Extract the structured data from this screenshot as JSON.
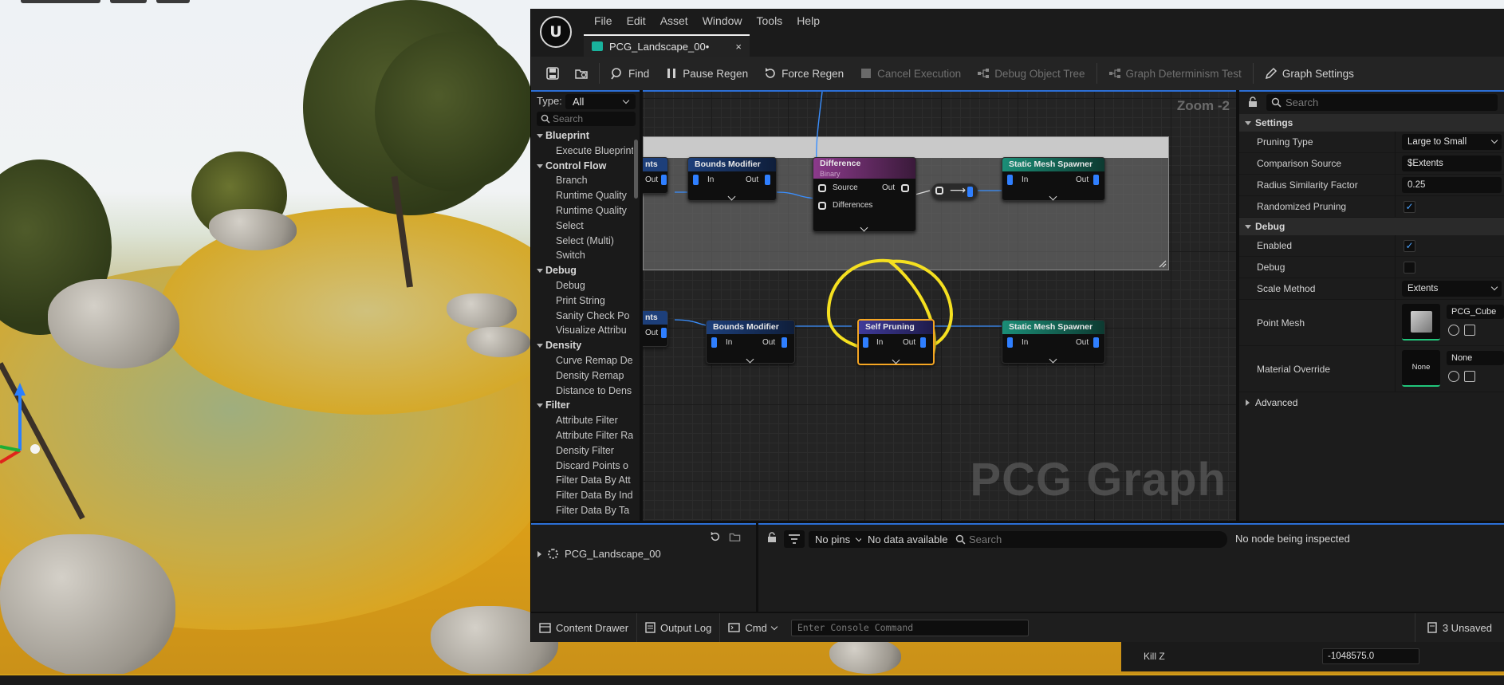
{
  "window": {
    "menu": [
      "File",
      "Edit",
      "Asset",
      "Window",
      "Tools",
      "Help"
    ],
    "tab_title": "PCG_Landscape_00•",
    "tab_close": "×"
  },
  "toolbar": {
    "find": "Find",
    "pause_regen": "Pause Regen",
    "force_regen": "Force Regen",
    "cancel_execution": "Cancel Execution",
    "debug_object_tree": "Debug Object Tree",
    "graph_determinism_test": "Graph Determinism Test",
    "graph_settings": "Graph Settings"
  },
  "palette": {
    "type_label": "Type:",
    "type_value": "All",
    "search_placeholder": "Search",
    "groups": [
      {
        "category": "Blueprint",
        "items": [
          "Execute Blueprint"
        ]
      },
      {
        "category": "Control Flow",
        "items": [
          "Branch",
          "Runtime Quality",
          "Runtime Quality",
          "Select",
          "Select (Multi)",
          "Switch"
        ]
      },
      {
        "category": "Debug",
        "items": [
          "Debug",
          "Print String",
          "Sanity Check Po",
          "Visualize Attribu"
        ]
      },
      {
        "category": "Density",
        "items": [
          "Curve Remap De",
          "Density Remap",
          "Distance to Dens"
        ]
      },
      {
        "category": "Filter",
        "items": [
          "Attribute Filter",
          "Attribute Filter Ra",
          "Density Filter",
          "Discard Points o",
          "Filter Data By Att",
          "Filter Data By Ind",
          "Filter Data By Ta"
        ]
      }
    ]
  },
  "graph": {
    "zoom": "Zoom -2",
    "watermark": "PCG Graph",
    "nodes": {
      "partial_top": "nts",
      "partial_bottom": "nts",
      "bounds_modifier_1": "Bounds Modifier",
      "difference": "Difference",
      "difference_sub": "Binary",
      "static_mesh_spawner_1": "Static Mesh Spawner",
      "bounds_modifier_2": "Bounds Modifier",
      "self_pruning": "Self Pruning",
      "static_mesh_spawner_2": "Static Mesh Spawner"
    },
    "pins": {
      "in": "In",
      "out": "Out",
      "source": "Source",
      "differences": "Differences"
    }
  },
  "details": {
    "search_placeholder": "Search",
    "settings_section": "Settings",
    "pruning_type_label": "Pruning Type",
    "pruning_type_value": "Large to Small",
    "comparison_source_label": "Comparison Source",
    "comparison_source_value": "$Extents",
    "radius_similarity_label": "Radius Similarity Factor",
    "radius_similarity_value": "0.25",
    "randomized_pruning_label": "Randomized Pruning",
    "randomized_pruning_checked": "✓",
    "debug_section": "Debug",
    "enabled_label": "Enabled",
    "enabled_checked": "✓",
    "debug_label": "Debug",
    "scale_method_label": "Scale Method",
    "scale_method_value": "Extents",
    "point_mesh_label": "Point Mesh",
    "point_mesh_value": "PCG_Cube",
    "material_override_label": "Material Override",
    "material_override_thumb": "None",
    "material_override_value": "None",
    "advanced_section": "Advanced"
  },
  "debug_tree": {
    "item": "PCG_Landscape_00"
  },
  "inspector": {
    "pins_select": "No pins",
    "data_select": "No data available",
    "search_placeholder": "Search",
    "status": "No node being inspected"
  },
  "statusbar": {
    "content_drawer": "Content Drawer",
    "output_log": "Output Log",
    "cmd": "Cmd",
    "console_placeholder": "Enter Console Command",
    "unsaved": "3 Unsaved"
  },
  "world_settings": {
    "kill_z_label": "Kill Z",
    "kill_z_value": "-1048575.0"
  }
}
